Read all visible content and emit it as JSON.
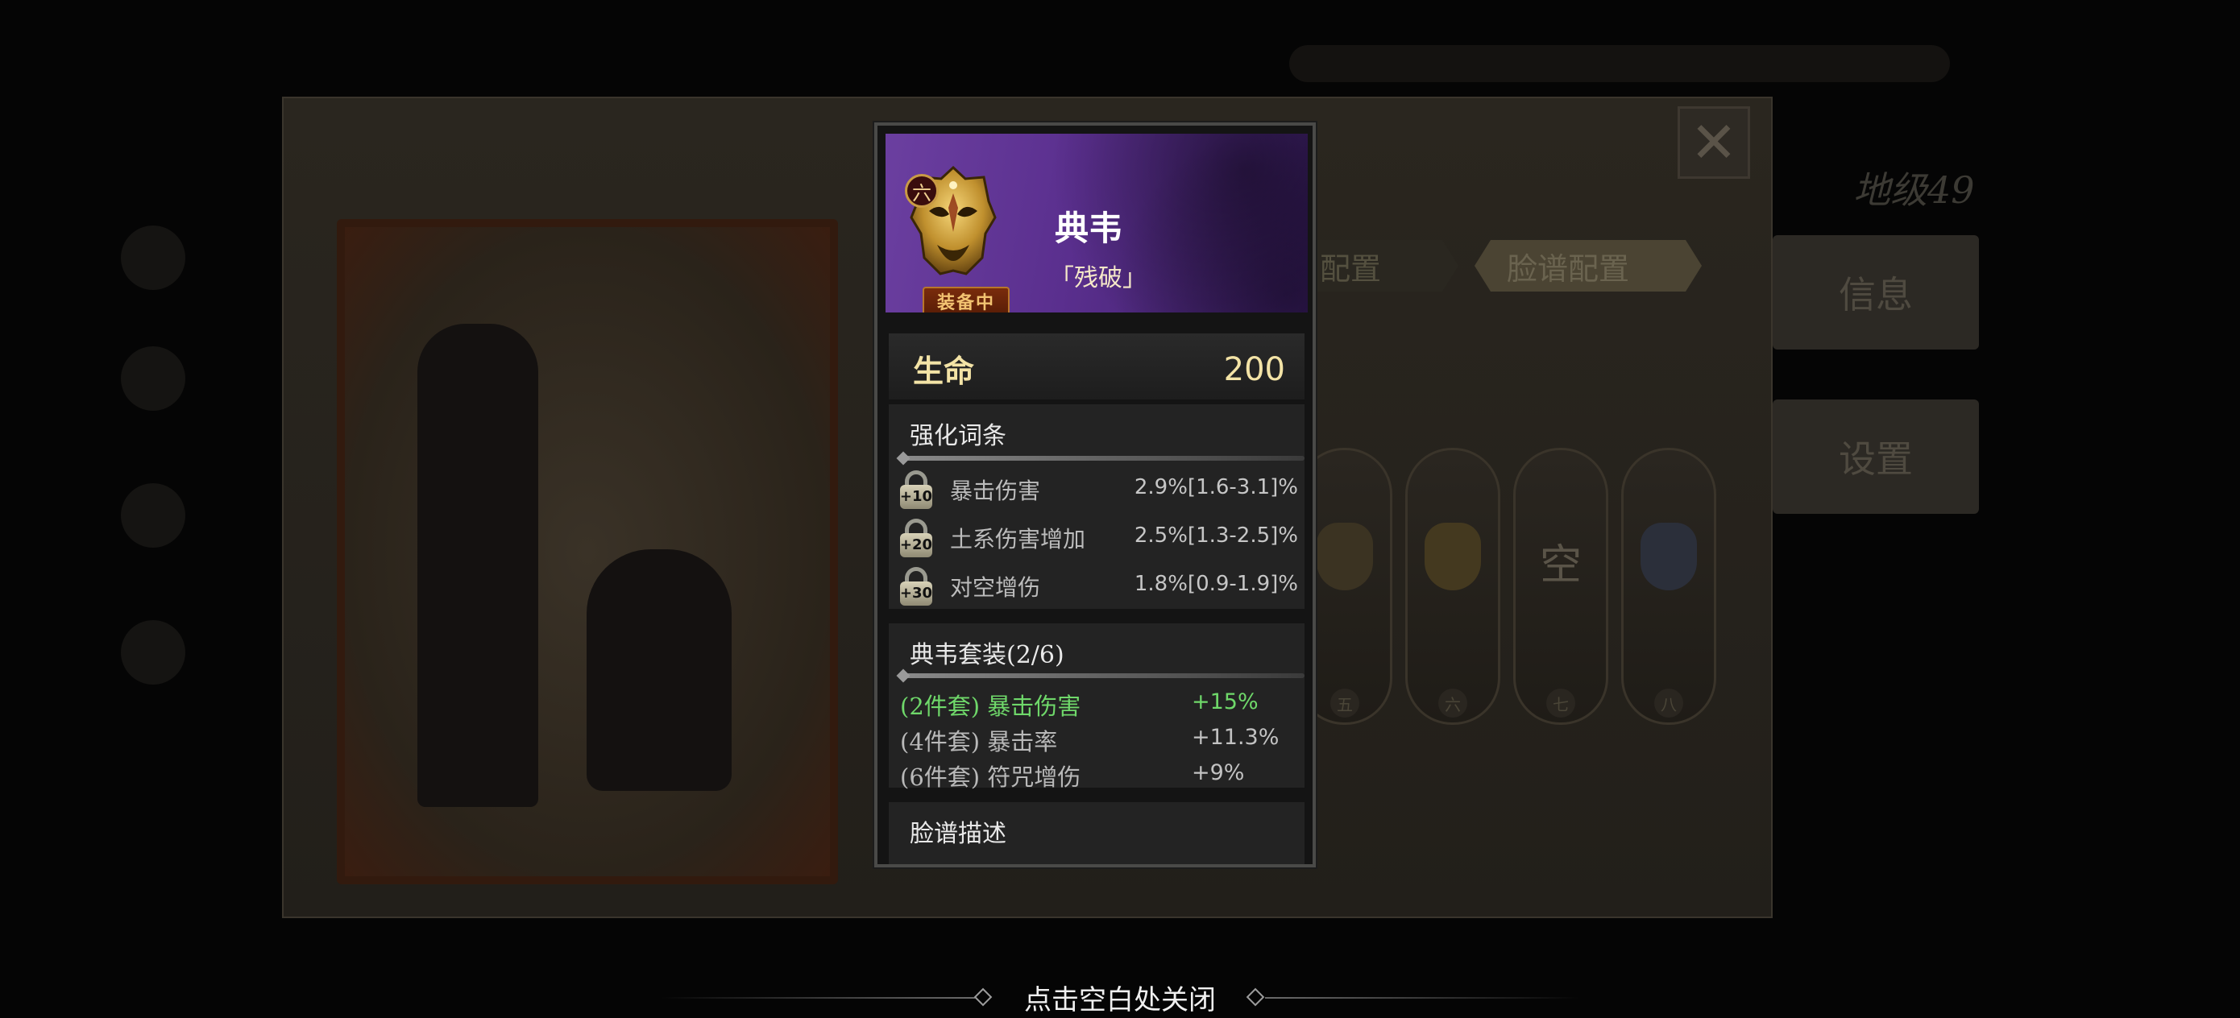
{
  "popup": {
    "rank_badge": "六",
    "equipped_label": "装备中",
    "name": "典韦",
    "subtitle": "「残破」",
    "hp_label": "生命",
    "hp_value": "200",
    "affix_title": "强化词条",
    "affixes": [
      {
        "lock_level": "+10",
        "name": "暴击伤害",
        "value": "2.9%[1.6-3.1]%"
      },
      {
        "lock_level": "+20",
        "name": "土系伤害增加",
        "value": "2.5%[1.3-2.5]%"
      },
      {
        "lock_level": "+30",
        "name": "对空增伤",
        "value": "1.8%[0.9-1.9]%"
      }
    ],
    "set_title": "典韦套装(2/6)",
    "set_bonuses": [
      {
        "label": "(2件套) 暴击伤害",
        "value": "+15%",
        "active": true
      },
      {
        "label": "(4件套) 暴击率",
        "value": "+11.3%",
        "active": false
      },
      {
        "label": "(6件套) 符咒增伤",
        "value": "+9%",
        "active": false
      }
    ],
    "desc_title": "脸谱描述"
  },
  "background": {
    "tab_1": "尸配置",
    "tab_2": "脸谱配置",
    "side_info": "信息",
    "side_settings": "设置",
    "slot_empty": "空",
    "slot_numbers": [
      "五",
      "六",
      "七",
      "八"
    ]
  },
  "hint": {
    "close_text": "点击空白处关闭"
  },
  "colors": {
    "hero_purple": "#5a2f8e",
    "hp_gold": "#f3e3a6",
    "active_green": "#6fd86a"
  }
}
